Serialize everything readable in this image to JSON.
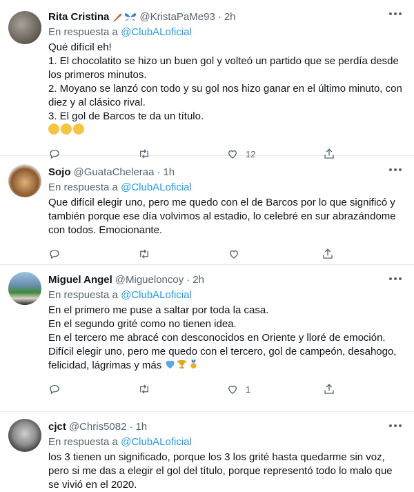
{
  "tweets": [
    {
      "name": "Rita Cristina",
      "handle": "@KristaPaMe93",
      "time": "2h",
      "reply_prefix": "En respuesta a",
      "mention": "@ClubALoficial",
      "lines": [
        "Qué difícil eh!",
        "1. El chocolatito se hizo un buen gol y volteó un partido que se perdía desde los primeros minutos.",
        "2. Moyano se lanzó con todo y su gol nos hizo ganar en el último minuto, con diez y al clásico rival.",
        "3. El gol de Barcos te da un título."
      ],
      "emojis": [
        "relieved-face",
        "relieved-face",
        "relieved-face"
      ],
      "like_count": "12"
    },
    {
      "name": "Sojo",
      "handle": "@GuataCheleraa",
      "time": "1h",
      "reply_prefix": "En respuesta a",
      "mention": "@ClubALoficial",
      "lines": [
        "Que difícil elegir uno, pero me quedo con el de Barcos por lo que significó y también porque ese día volvimos al estadio, lo celebré en sur abrazándome con todos. Emocionante."
      ],
      "like_count": ""
    },
    {
      "name": "Miguel Angel",
      "handle": "@Migueloncoy",
      "time": "2h",
      "reply_prefix": "En respuesta a",
      "mention": "@ClubALoficial",
      "lines": [
        "En el primero me puse a saltar por toda la casa.",
        "En el segundo grité como no tienen idea.",
        "En el tercero me abracé con desconocidos en Oriente y lloré de emoción.",
        "Difícil elegir uno, pero me quedo con el tercero, gol de campeón, desahogo, felicidad, lágrimas y más"
      ],
      "emojis": [
        "blue-heart",
        "trophy",
        "medal"
      ],
      "like_count": "1"
    },
    {
      "name": "cjct",
      "handle": "@Chris5082",
      "time": "1h",
      "reply_prefix": "En respuesta a",
      "mention": "@ClubALoficial",
      "lines": [
        "los 3 tienen un significado, porque los 3 los grité hasta quedarme sin voz, pero si me das a elegir el gol del título, porque representó todo lo malo que se vivió en el 2020."
      ]
    }
  ],
  "colors": {
    "accent": "#1d9bf0",
    "muted": "#536471",
    "text": "#0f1419",
    "divider": "#e7e9ea"
  },
  "icons": [
    "reply-icon",
    "retweet-icon",
    "like-icon",
    "share-icon",
    "more-icon",
    "feather-icon",
    "butterfly-icon"
  ]
}
